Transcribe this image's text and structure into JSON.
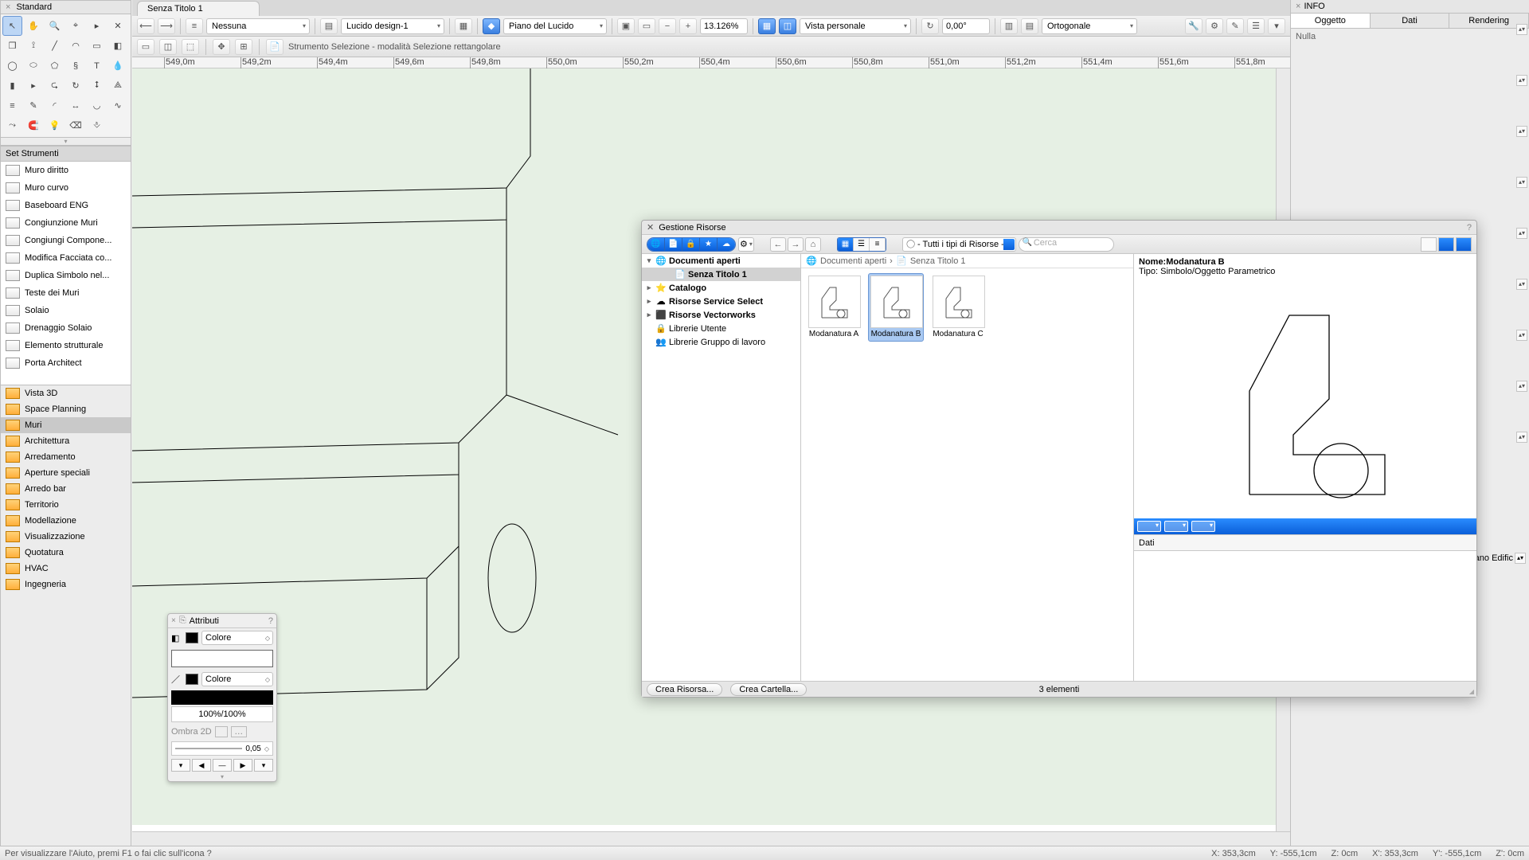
{
  "standard": {
    "title": "Standard",
    "set_title": "Set Strumenti",
    "tools": [
      "cursor",
      "pan",
      "zoom",
      "zoom-area",
      "flyout",
      "x",
      "box3d",
      "constrain",
      "line",
      "arc-flyout",
      "rect",
      "rounded",
      "circle",
      "ellipse",
      "poly-flyout",
      "spiral",
      "text",
      "eyedrop",
      "wall",
      "extr-flyout",
      "mirror",
      "rotate",
      "scale",
      "shear",
      "align-flyout",
      "brush",
      "fillet",
      "dim",
      "arc2",
      "curve",
      "pick",
      "magnet",
      "light",
      "erase",
      "place"
    ],
    "set_items": [
      "Muro diritto",
      "Muro curvo",
      "Baseboard ENG",
      "Congiunzione Muri",
      "Congiungi Compone...",
      "Modifica Facciata co...",
      "Duplica Simbolo nel...",
      "Teste dei Muri",
      "Solaio",
      "Drenaggio Solaio",
      "Elemento strutturale",
      "Porta Architect"
    ],
    "categories": [
      "Vista 3D",
      "Space Planning",
      "Muri",
      "Architettura",
      "Arredamento",
      "Aperture speciali",
      "Arredo bar",
      "Territorio",
      "Modellazione",
      "Visualizzazione",
      "Quotatura",
      "HVAC",
      "Ingegneria"
    ],
    "selected_category": "Muri"
  },
  "doc": {
    "tab": "Senza Titolo 1",
    "toolbar1": {
      "class_sel": "Nessuna",
      "layer_sel": "Lucido design-1",
      "plane_sel": "Piano del Lucido",
      "zoom": "13.126%",
      "view_sel": "Vista personale",
      "angle": "0,00°",
      "proj_sel": "Ortogonale"
    },
    "toolbar2": {
      "mode_label": "Strumento Selezione - modalità Selezione rettangolare"
    },
    "ruler_ticks": [
      "549,0m",
      "549,2m",
      "549,4m",
      "549,6m",
      "549,8m",
      "550,0m",
      "550,2m",
      "550,4m",
      "550,6m",
      "550,8m",
      "551,0m",
      "551,2m",
      "551,4m",
      "551,6m",
      "551,8m"
    ]
  },
  "info": {
    "title": "INFO",
    "tabs": [
      "Oggetto",
      "Dati",
      "Rendering"
    ],
    "body": "Nulla",
    "piano_label": "Piano Edific"
  },
  "attributi": {
    "title": "Attributi",
    "color_label": "Colore",
    "pct": "100%/100%",
    "ombra": "Ombra 2D",
    "slider_val": "0,05"
  },
  "resmgr": {
    "title": "Gestione Risorse",
    "type_sel": "- Tutti i tipi di Risorse -",
    "search_ph": "Cerca",
    "tree": [
      {
        "label": "Documenti aperti",
        "bold": true,
        "tw": "▾",
        "ic": "🌐",
        "ind": 0
      },
      {
        "label": "Senza Titolo 1",
        "bold": true,
        "sel": true,
        "tw": "",
        "ic": "📄",
        "ind": 2
      },
      {
        "label": "Catalogo",
        "bold": true,
        "tw": "▸",
        "ic": "⭐",
        "ind": 0
      },
      {
        "label": "Risorse Service Select",
        "bold": true,
        "tw": "▸",
        "ic": "☁",
        "ind": 0
      },
      {
        "label": "Risorse Vectorworks",
        "bold": true,
        "tw": "▸",
        "ic": "⬛",
        "ind": 0
      },
      {
        "label": "Librerie Utente",
        "tw": "",
        "ic": "🔒",
        "ind": 0
      },
      {
        "label": "Librerie Gruppo di lavoro",
        "tw": "",
        "ic": "👥",
        "ind": 0
      }
    ],
    "crumb1": "Documenti aperti",
    "crumb2": "Senza Titolo 1",
    "thumbs": [
      {
        "label": "Modanatura A",
        "sel": false
      },
      {
        "label": "Modanatura B",
        "sel": true
      },
      {
        "label": "Modanatura C",
        "sel": false
      }
    ],
    "preview_name_label": "Nome:",
    "preview_name": "Modanatura B",
    "preview_type_label": "Tipo: ",
    "preview_type": "Simbolo/Oggetto Parametrico",
    "data_label": "Dati",
    "btn_resource": "Crea Risorsa...",
    "btn_folder": "Crea Cartella...",
    "count": "3 elementi"
  },
  "status": {
    "help": "Per visualizzare l'Aiuto, premi F1 o fai clic sull'icona ?",
    "coords": [
      "X: 353,3cm",
      "Y: -555,1cm",
      "Z: 0cm",
      "X': 353,3cm",
      "Y': -555,1cm",
      "Z': 0cm"
    ]
  }
}
